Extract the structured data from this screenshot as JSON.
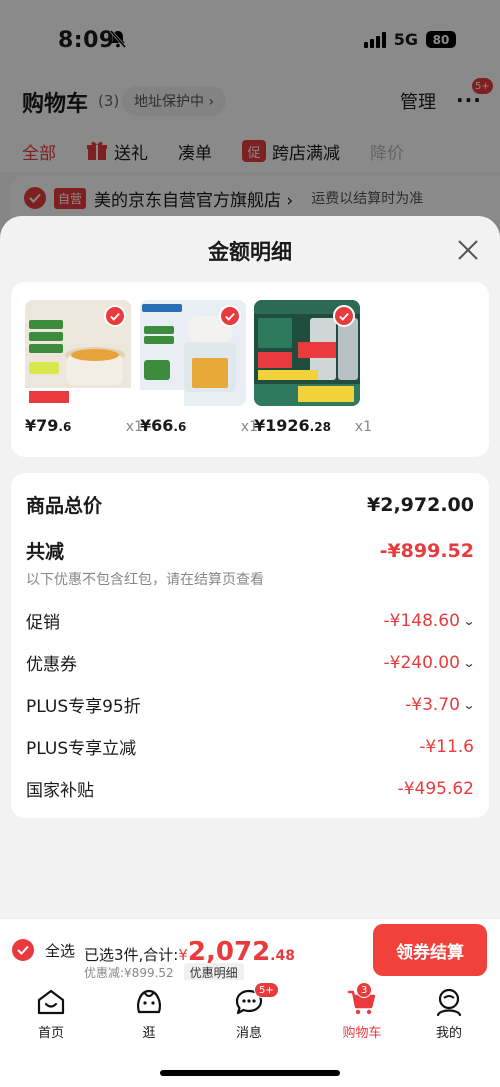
{
  "status_bar": {
    "time": "8:09",
    "network": "5G",
    "battery": "80"
  },
  "header": {
    "title": "购物车",
    "count": "(3)",
    "address_label": "地址保护中 ›",
    "manage_label": "管理",
    "more_label": "···",
    "more_badge": "5+"
  },
  "filter_tabs": [
    {
      "label": "全部"
    },
    {
      "label": "送礼"
    },
    {
      "label": "凑单"
    },
    {
      "label": "跨店满减",
      "icon_text": "促"
    },
    {
      "label": "降价"
    }
  ],
  "store": {
    "tag": "自营",
    "name": "美的京东自营官方旗舰店 ›",
    "shipping_note": "运费以结算时为准"
  },
  "sheet": {
    "title": "金额明细",
    "products": [
      {
        "price_main": "¥79",
        "price_dec": ".6",
        "qty": "x1",
        "image": "stew-pot-product",
        "accent": "#c9a66b"
      },
      {
        "price_main": "¥66",
        "price_dec": ".6",
        "qty": "x1",
        "image": "food-chopper-product",
        "accent": "#e6b35a"
      },
      {
        "price_main": "¥1926",
        "price_dec": ".28",
        "qty": "x1",
        "image": "air-conditioner-product",
        "accent": "#2a5c4a"
      }
    ],
    "summary": {
      "total_label": "商品总价",
      "total_value": "¥2,972.00",
      "reduction_label": "共减",
      "reduction_value": "-¥899.52",
      "reduction_note": "以下优惠不包含红包，请在结算页查看",
      "items": [
        {
          "label": "促销",
          "value": "-¥148.60",
          "expandable": "⌄"
        },
        {
          "label": "优惠券",
          "value": "-¥240.00",
          "expandable": "⌄"
        },
        {
          "label": "PLUS专享95折",
          "value": "-¥3.70",
          "expandable": "⌄"
        },
        {
          "label": "PLUS专享立减",
          "value": "-¥11.6",
          "expandable": ""
        },
        {
          "label": "国家补贴",
          "value": "-¥495.62",
          "expandable": ""
        }
      ]
    }
  },
  "checkout": {
    "select_all": "全选",
    "selected_text": "已选3件,合计:",
    "yen": "¥",
    "total_main": "2,072",
    "total_dec": ".48",
    "discount_text": "优惠减:¥899.52",
    "discount_detail_label": "优惠明细",
    "submit_label": "领券结算"
  },
  "nav": [
    {
      "label": "首页",
      "icon": "home-icon"
    },
    {
      "label": "逛",
      "icon": "browse-icon"
    },
    {
      "label": "消息",
      "icon": "message-icon",
      "badge": "5+"
    },
    {
      "label": "购物车",
      "icon": "cart-icon",
      "badge": "3",
      "active": true
    },
    {
      "label": "我的",
      "icon": "profile-icon"
    }
  ],
  "colors": {
    "accent": "#e93b3d",
    "submit": "#f0413b"
  }
}
